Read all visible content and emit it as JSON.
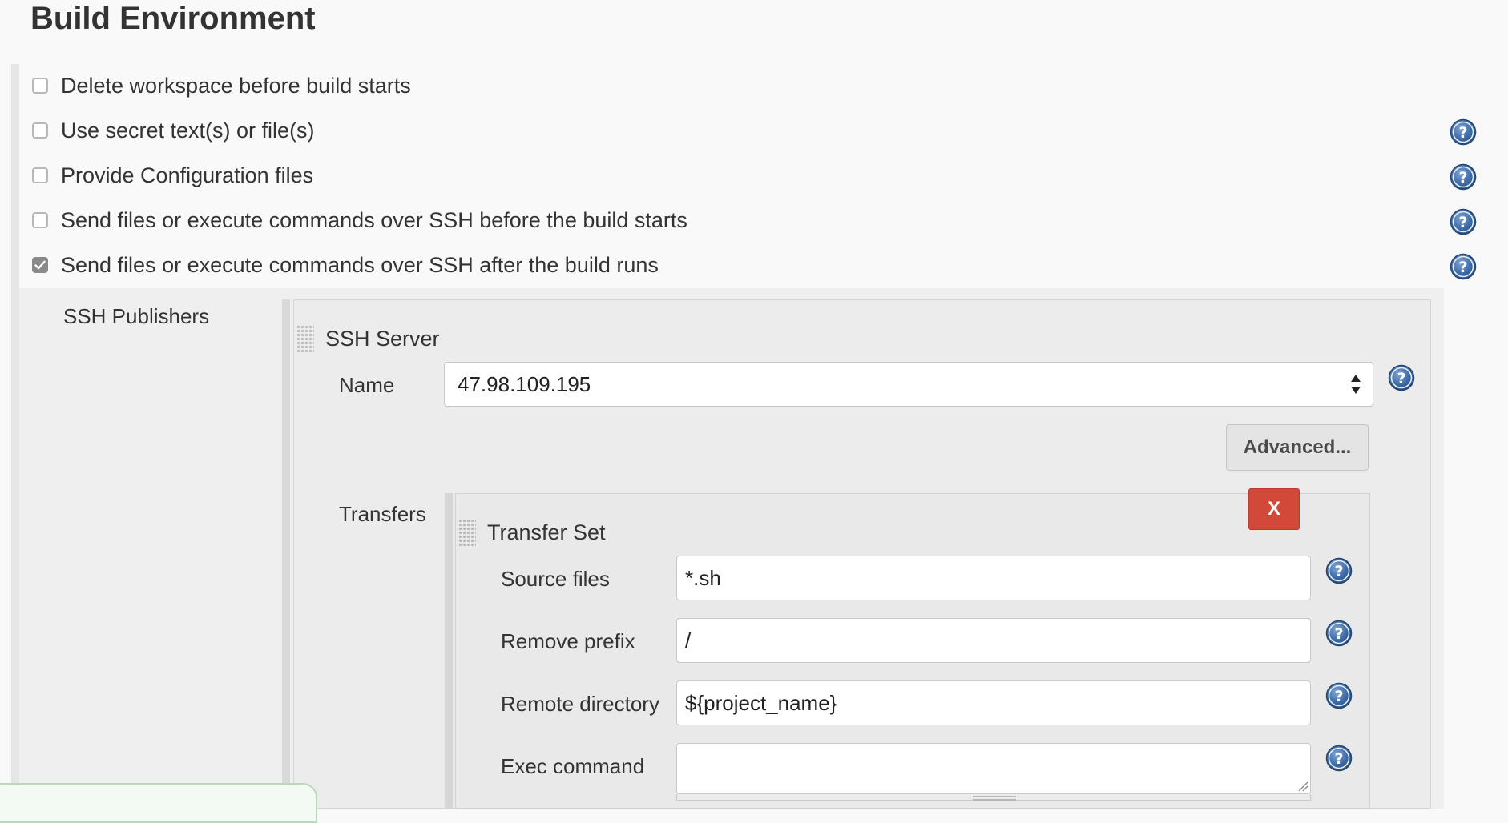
{
  "section": {
    "title": "Build Environment"
  },
  "options": [
    {
      "label": "Delete workspace before build starts",
      "checked": false,
      "has_help": false
    },
    {
      "label": "Use secret text(s) or file(s)",
      "checked": false,
      "has_help": true
    },
    {
      "label": "Provide Configuration files",
      "checked": false,
      "has_help": true
    },
    {
      "label": "Send files or execute commands over SSH before the build starts",
      "checked": false,
      "has_help": true
    },
    {
      "label": "Send files or execute commands over SSH after the build runs",
      "checked": true,
      "has_help": true
    }
  ],
  "ssh_publishers": {
    "label": "SSH Publishers",
    "server": {
      "title": "SSH Server",
      "name_label": "Name",
      "name_value": "47.98.109.195",
      "advanced_label": "Advanced..."
    },
    "transfers": {
      "label": "Transfers",
      "set_title": "Transfer Set",
      "delete_label": "X",
      "fields": {
        "source_files": {
          "label": "Source files",
          "value": "*.sh"
        },
        "remove_prefix": {
          "label": "Remove prefix",
          "value": "/"
        },
        "remote_directory": {
          "label": "Remote directory",
          "value": "${project_name}"
        },
        "exec_command": {
          "label": "Exec command",
          "value": ""
        }
      }
    }
  },
  "icons": {
    "help": "help-icon",
    "checkmark": "checkmark-icon",
    "drag": "drag-handle-icon",
    "select_arrows": "select-arrows-icon"
  },
  "colors": {
    "help_blue": "#3d6ba8",
    "delete_red": "#d24939",
    "checked_gray": "#8a8a8a"
  }
}
